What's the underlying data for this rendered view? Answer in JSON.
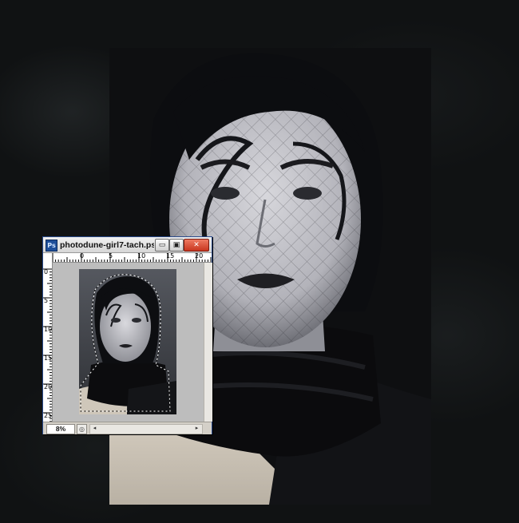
{
  "document": {
    "title": "photodune-girl7-tach.psd ...",
    "app_icon": "Ps",
    "zoom": "8%"
  },
  "window_buttons": {
    "minimize": "▭",
    "maximize": "▣",
    "close": "✕"
  },
  "rulers": {
    "horizontal_labels": [
      "0",
      "5",
      "10",
      "15",
      "20"
    ],
    "vertical_labels": [
      "0",
      "5",
      "10",
      "15",
      "20",
      "25"
    ]
  },
  "icons": {
    "app": "photoshop-icon",
    "status": "status-menu-icon",
    "scroll_left": "◂",
    "scroll_right": "▸"
  },
  "colors": {
    "title_close": "#c8361f",
    "window_frame": "#d4d0c8",
    "canvas_bg": "#bdbdbd"
  }
}
